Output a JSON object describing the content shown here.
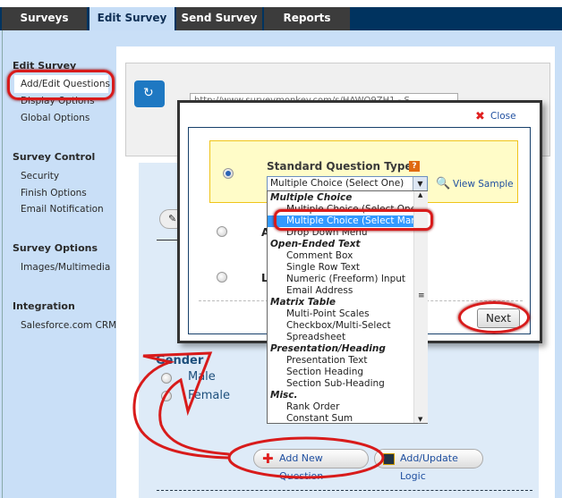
{
  "tabs": [
    {
      "label": "Surveys"
    },
    {
      "label": "Edit Survey",
      "active": true
    },
    {
      "label": "Send Survey"
    },
    {
      "label": "Reports"
    }
  ],
  "sidebar": {
    "sections": [
      {
        "title": "Edit Survey",
        "items": [
          "Add/Edit Questions",
          "Display Options",
          "Global Options"
        ]
      },
      {
        "title": "Survey Control",
        "items": [
          "Security",
          "Finish Options",
          "Email Notification"
        ]
      },
      {
        "title": "Survey Options",
        "items": [
          "Images/Multimedia"
        ]
      },
      {
        "title": "Integration",
        "items": [
          "Salesforce.com CRM"
        ]
      }
    ]
  },
  "url_field": {
    "value": "http://www.surveymonkey.com/s/HAWQ9ZH1 - S"
  },
  "modal": {
    "close_label": "Close",
    "standard_title": "Standard Question Types",
    "select_value": "Multiple Choice (Select One)",
    "view_sample": "View Sample",
    "option2_partial": "A",
    "option3_partial": "L",
    "next_label": "Next",
    "list": [
      {
        "text": "Multiple Choice",
        "group": true
      },
      {
        "text": "Multiple Choice (Select One)"
      },
      {
        "text": "Multiple Choice (Select Many)",
        "selected": true
      },
      {
        "text": "Drop Down Menu"
      },
      {
        "text": "Open-Ended Text",
        "group": true
      },
      {
        "text": "Comment Box"
      },
      {
        "text": "Single Row Text"
      },
      {
        "text": "Numeric (Freeform) Input"
      },
      {
        "text": "Email Address"
      },
      {
        "text": "Matrix Table",
        "group": true
      },
      {
        "text": "Multi-Point Scales"
      },
      {
        "text": "Checkbox/Multi-Select"
      },
      {
        "text": "Spreadsheet"
      },
      {
        "text": "Presentation/Heading",
        "group": true
      },
      {
        "text": "Presentation Text"
      },
      {
        "text": "Section Heading"
      },
      {
        "text": "Section Sub-Heading"
      },
      {
        "text": "Misc.",
        "group": true
      },
      {
        "text": "Rank Order"
      },
      {
        "text": "Constant Sum"
      }
    ]
  },
  "question": {
    "title": "Gender",
    "options": [
      "Male",
      "Female"
    ]
  },
  "buttons": {
    "add_question": "Add New Question",
    "add_logic": "Add/Update Logic"
  },
  "colors": {
    "nav": "#00335f",
    "tab": "#3c3c3c",
    "active_tab": "#c6ddf6",
    "highlight": "#d81b1b",
    "selection": "#3399ff"
  }
}
